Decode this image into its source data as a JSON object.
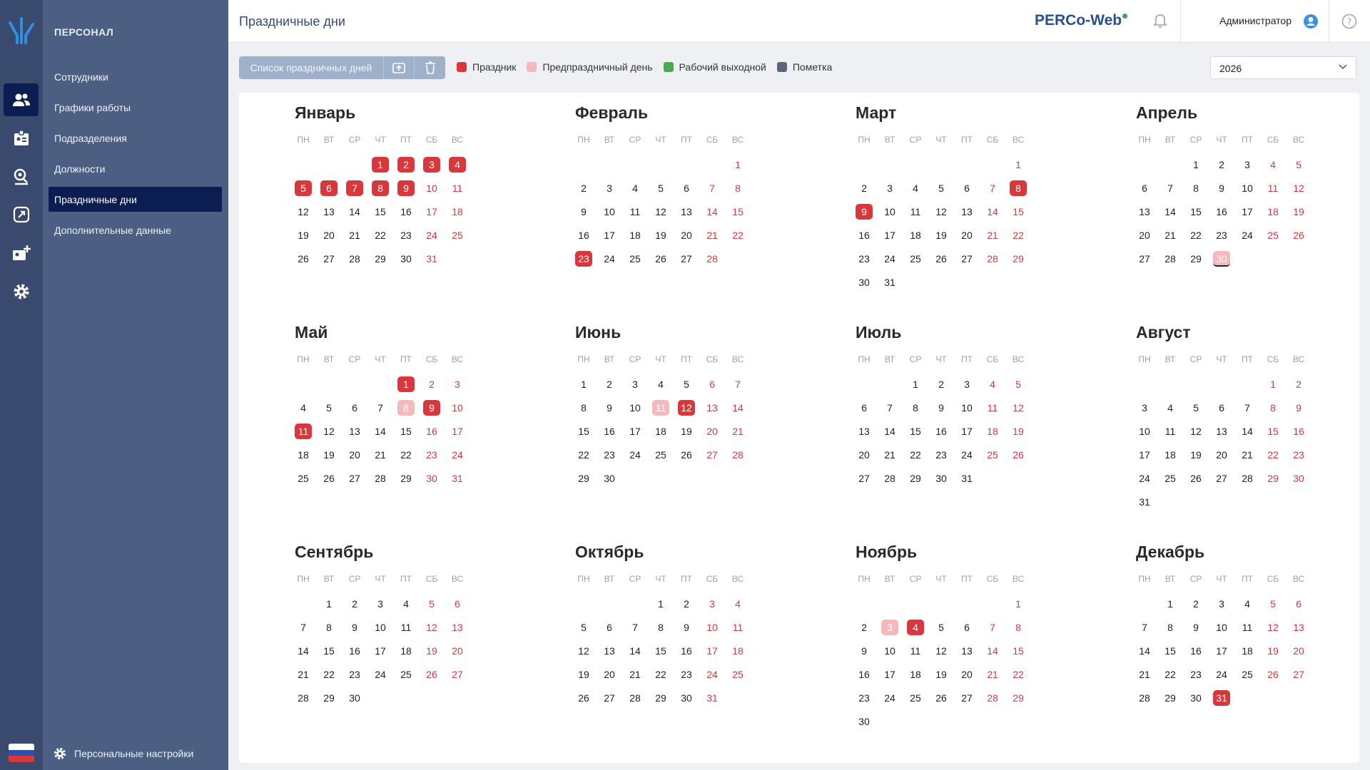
{
  "app": {
    "brand": "PERCo-Web"
  },
  "header": {
    "title": "Праздничные дни",
    "user": "Администратор"
  },
  "nav": {
    "section": "ПЕРСОНАЛ",
    "items": [
      {
        "label": "Сотрудники",
        "active": false
      },
      {
        "label": "Графики работы",
        "active": false
      },
      {
        "label": "Подразделения",
        "active": false
      },
      {
        "label": "Должности",
        "active": false
      },
      {
        "label": "Праздничные дни",
        "active": true
      },
      {
        "label": "Дополнительные данные",
        "active": false
      }
    ],
    "footer": "Персональные настройки"
  },
  "rail": {
    "icons": [
      "personnel-icon",
      "badge-icon",
      "access-icon",
      "link-icon",
      "add-card-icon",
      "settings-icon"
    ]
  },
  "toolbar": {
    "list_label": "Список праздничных дней"
  },
  "legend": [
    {
      "label": "Праздник",
      "color": "#d9373c"
    },
    {
      "label": "Предпраздничный день",
      "color": "#f5b9bc"
    },
    {
      "label": "Рабочий выходной",
      "color": "#4aaa4e"
    },
    {
      "label": "Пометка",
      "color": "#5b6478"
    }
  ],
  "year": "2026",
  "weekdays": [
    "ПН",
    "ВТ",
    "СР",
    "ЧТ",
    "ПТ",
    "СБ",
    "ВС"
  ],
  "months": [
    {
      "name": "Январь",
      "start": 3,
      "days": 31,
      "holidays": [
        1,
        2,
        3,
        4,
        5,
        6,
        7,
        8,
        9
      ],
      "preholidays": [],
      "weekends": [
        10,
        11,
        17,
        18,
        24,
        25,
        31
      ]
    },
    {
      "name": "Февраль",
      "start": 6,
      "days": 28,
      "holidays": [
        23
      ],
      "preholidays": [],
      "weekends": [
        1,
        7,
        8,
        14,
        15,
        21,
        22,
        28
      ]
    },
    {
      "name": "Март",
      "start": 6,
      "days": 31,
      "holidays": [
        8,
        9
      ],
      "preholidays": [],
      "weekends": [
        1,
        7,
        14,
        15,
        21,
        22,
        28,
        29
      ]
    },
    {
      "name": "Апрель",
      "start": 2,
      "days": 30,
      "holidays": [],
      "preholidays": [
        30
      ],
      "weekends": [
        4,
        5,
        11,
        12,
        18,
        19,
        25,
        26
      ],
      "today": 30
    },
    {
      "name": "Май",
      "start": 4,
      "days": 31,
      "holidays": [
        1,
        9,
        11
      ],
      "preholidays": [
        8
      ],
      "weekends": [
        2,
        3,
        10,
        16,
        17,
        23,
        24,
        30,
        31
      ]
    },
    {
      "name": "Июнь",
      "start": 0,
      "days": 30,
      "holidays": [
        12
      ],
      "preholidays": [
        11
      ],
      "weekends": [
        6,
        7,
        13,
        14,
        20,
        21,
        27,
        28
      ]
    },
    {
      "name": "Июль",
      "start": 2,
      "days": 31,
      "holidays": [],
      "preholidays": [],
      "weekends": [
        4,
        5,
        11,
        12,
        18,
        19,
        25,
        26
      ]
    },
    {
      "name": "Август",
      "start": 5,
      "days": 31,
      "holidays": [],
      "preholidays": [],
      "weekends": [
        1,
        2,
        8,
        9,
        15,
        16,
        22,
        23,
        29,
        30
      ]
    },
    {
      "name": "Сентябрь",
      "start": 1,
      "days": 30,
      "holidays": [],
      "preholidays": [],
      "weekends": [
        5,
        6,
        12,
        13,
        19,
        20,
        26,
        27
      ]
    },
    {
      "name": "Октябрь",
      "start": 3,
      "days": 31,
      "holidays": [],
      "preholidays": [],
      "weekends": [
        3,
        4,
        10,
        11,
        17,
        18,
        24,
        25,
        31
      ]
    },
    {
      "name": "Ноябрь",
      "start": 6,
      "days": 30,
      "holidays": [
        4
      ],
      "preholidays": [
        3
      ],
      "weekends": [
        1,
        7,
        8,
        14,
        15,
        21,
        22,
        28,
        29
      ]
    },
    {
      "name": "Декабрь",
      "start": 1,
      "days": 31,
      "holidays": [
        31
      ],
      "preholidays": [],
      "weekends": [
        5,
        6,
        12,
        13,
        19,
        20,
        26,
        27
      ]
    }
  ]
}
